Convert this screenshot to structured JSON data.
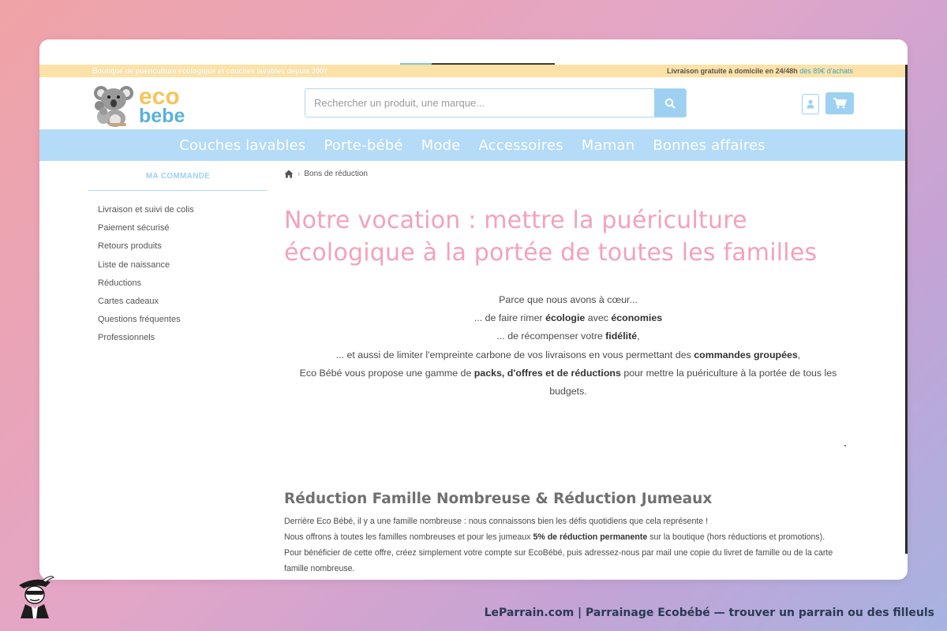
{
  "topbar": {
    "left_text": "Boutique de puériculture écologique et couches lavables depuis 2007",
    "right_text": "Livraison gratuite à domicile en 24/48h",
    "right_highlight": "dès 89€ d'achats"
  },
  "logo": {
    "eco": "eco",
    "bebe": "bebe"
  },
  "search": {
    "placeholder": "Rechercher un produit, une marque..."
  },
  "nav": [
    "Couches lavables",
    "Porte-bébé",
    "Mode",
    "Accessoires",
    "Maman",
    "Bonnes affaires"
  ],
  "sidebar": {
    "title": "MA COMMANDE",
    "items": [
      "Livraison et suivi de colis",
      "Paiement sécurisé",
      "Retours produits",
      "Liste de naissance",
      "Réductions",
      "Cartes cadeaux",
      "Questions fréquentes",
      "Professionnels"
    ]
  },
  "breadcrumb": {
    "current": "Bons de réduction"
  },
  "main": {
    "title": "Notre vocation : mettre la puériculture écologique à la portée de toutes les familles",
    "intro": {
      "line1": "Parce que nous avons à cœur...",
      "l2_pre": "... de faire rimer ",
      "l2_b1": "écologie",
      "l2_mid": " avec ",
      "l2_b2": "économies",
      "l3_pre": "... de récompenser votre ",
      "l3_b": "fidélité",
      "l3_post": ",",
      "l4_pre": "... et aussi de limiter l'empreinte carbone de vos livraisons en vous permettant des ",
      "l4_b": "commandes groupées",
      "l4_post": ",",
      "l5_pre": "Eco Bébé vous propose une gamme de ",
      "l5_b": "packs, d'offres et de réductions",
      "l5_post": " pour mettre la puériculture à la portée de tous les budgets."
    },
    "section_title": "Réduction Famille Nombreuse & Réduction Jumeaux",
    "p1": "Derrière Eco Bébé, il y a une famille nombreuse : nous connaissons bien les défis quotidiens que cela représente !",
    "p2_pre": "Nous offrons à toutes les familles nombreuses et pour les jumeaux ",
    "p2_b": "5% de réduction permanente",
    "p2_post": " sur la boutique (hors réductions et promotions).",
    "p3": "Pour bénéficier de cette offre, créez simplement votre compte sur EcoBébé, puis adressez-nous par mail une copie du livret de famille ou de la carte famille nombreuse."
  },
  "footer": {
    "text": "LeParrain.com | Parrainage Ecobébé — trouver un parrain ou des filleuls"
  },
  "colors": {
    "accent_blue": "#9ed1f1",
    "nav_blue": "#b4dbf8",
    "title_pink": "#f3a2ba",
    "topbar_yellow": "#fce2a6"
  }
}
